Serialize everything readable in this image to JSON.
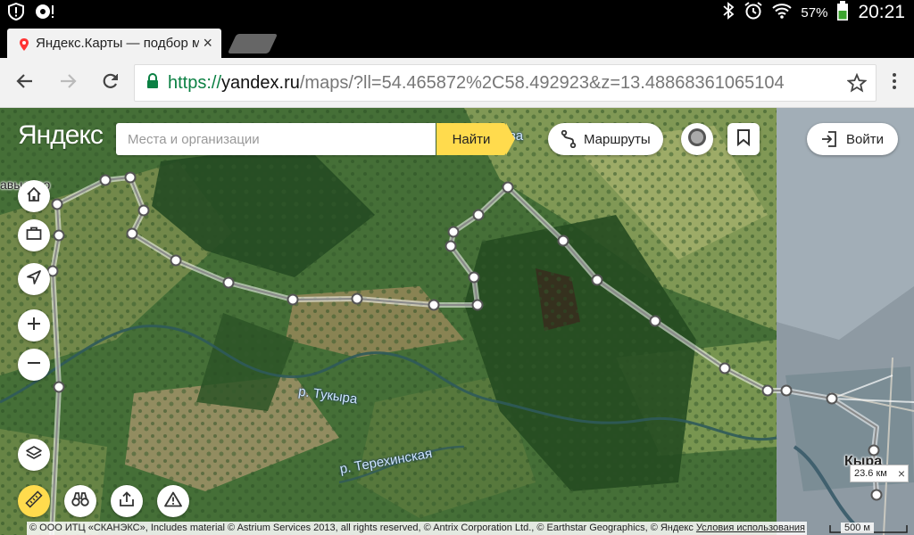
{
  "status_bar": {
    "left_icons": [
      "shield-alert-icon",
      "sync-alert-icon"
    ],
    "right_icons": [
      "bluetooth-icon",
      "alarm-icon",
      "wifi-icon",
      "battery-icon"
    ],
    "battery_percent": "57%",
    "time": "20:21"
  },
  "browser": {
    "tab_title": "Яндекс.Карты — подбор маршрута",
    "tab_close": "×",
    "url_scheme": "https://",
    "url_host": "yandex.ru",
    "url_path": "/maps/?ll=54.465872%2C58.492923&z=13.48868361065104"
  },
  "map": {
    "logo": "Яндекс",
    "search_placeholder": "Места и организации",
    "find_label": "Найти",
    "routes_label": "Маршруты",
    "login_label": "Войти",
    "labels": {
      "river_tukyra": "р. Тукыра",
      "river_terekhinskaya": "р. Терехинская",
      "place_left": "авыдово",
      "place_right": "Кыра",
      "place_top": "ва"
    },
    "distance": "23.6 км",
    "distance_close": "×",
    "scale": "500 м",
    "copyright": "© ООО ИТЦ «СКАНЭКС», Includes material © Astrium Services 2013, all rights reserved, © Antrix Corporation Ltd., © Earthstar Geographics, © Яндекс ",
    "terms": "Условия использования"
  }
}
